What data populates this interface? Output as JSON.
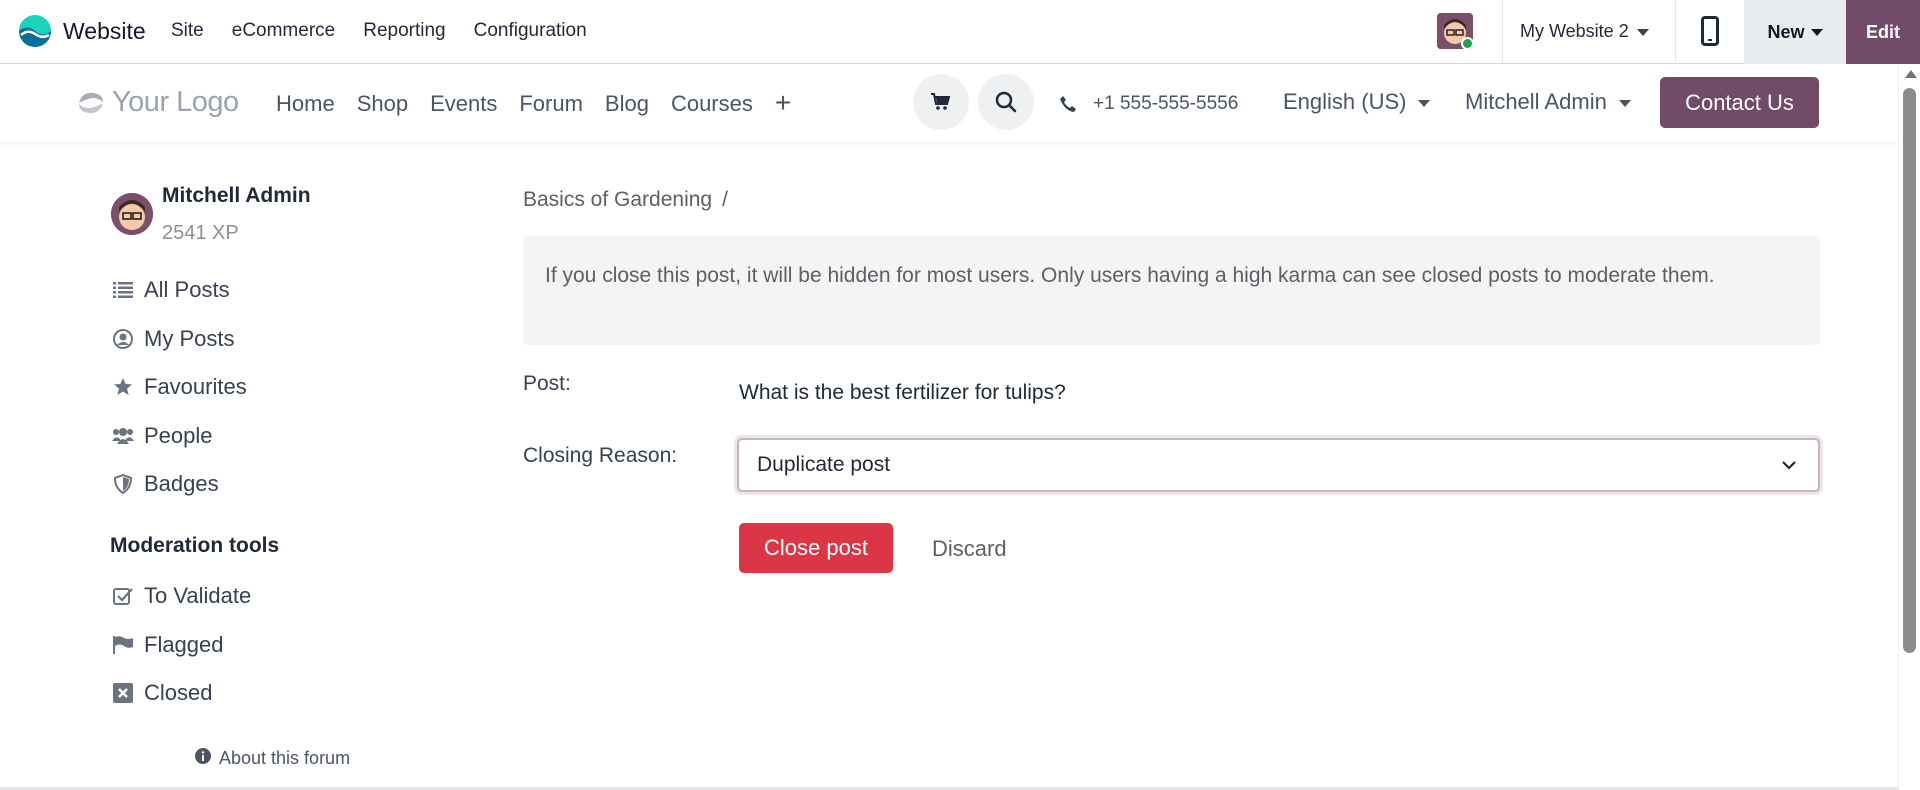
{
  "topbar": {
    "app_name": "Website",
    "menu": [
      "Site",
      "eCommerce",
      "Reporting",
      "Configuration"
    ],
    "website_selector": "My Website 2",
    "new_label": "New",
    "edit_label": "Edit",
    "accent_color": "#714b67"
  },
  "navbar": {
    "logo_text": "Your Logo",
    "links": [
      "Home",
      "Shop",
      "Events",
      "Forum",
      "Blog",
      "Courses"
    ],
    "plus_label": "+",
    "phone": "+1 555-555-5556",
    "language": "English (US)",
    "user": "Mitchell Admin",
    "contact_label": "Contact Us"
  },
  "sidebar": {
    "user_name": "Mitchell Admin",
    "user_xp": "2541 XP",
    "items": [
      {
        "label": "All Posts",
        "icon": "list-icon"
      },
      {
        "label": "My Posts",
        "icon": "user-circle-icon"
      },
      {
        "label": "Favourites",
        "icon": "star-icon"
      },
      {
        "label": "People",
        "icon": "users-icon"
      },
      {
        "label": "Badges",
        "icon": "shield-icon"
      }
    ],
    "moderation_title": "Moderation tools",
    "moderation_items": [
      {
        "label": "To Validate",
        "icon": "check-square-icon"
      },
      {
        "label": "Flagged",
        "icon": "flag-icon"
      },
      {
        "label": "Closed",
        "icon": "close-square-icon"
      }
    ],
    "about_label": "About this forum"
  },
  "main": {
    "breadcrumb": "Basics of Gardening",
    "breadcrumb_sep": "/",
    "alert_text": "If you close this post, it will be hidden for most users. Only users having a high karma can see closed posts to moderate them.",
    "post_label": "Post:",
    "post_title": "What is the best fertilizer for tulips?",
    "reason_label": "Closing Reason:",
    "reason_value": "Duplicate post",
    "close_button": "Close post",
    "discard_button": "Discard",
    "danger_color": "#dc3545"
  }
}
